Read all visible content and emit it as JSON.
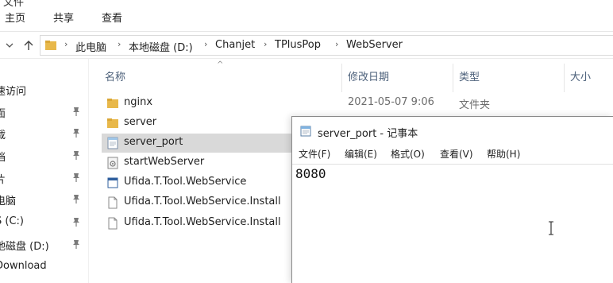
{
  "ribbon": {
    "tabs": [
      "主页",
      "共享",
      "查看"
    ],
    "top_cut_text": [
      "文件"
    ]
  },
  "address": {
    "crumbs": [
      "此电脑",
      "本地磁盘 (D:)",
      "Chanjet",
      "TPlusPop",
      "WebServer"
    ]
  },
  "navpane": {
    "items": [
      {
        "label": "速访问",
        "pinned": false
      },
      {
        "label": "面",
        "pinned": true
      },
      {
        "label": "载",
        "pinned": true
      },
      {
        "label": "档",
        "pinned": true
      },
      {
        "label": "片",
        "pinned": true
      },
      {
        "label": "电脑",
        "pinned": true
      },
      {
        "label": "S (C:)",
        "pinned": true
      },
      {
        "label": "地磁盘 (D:)",
        "pinned": true
      },
      {
        "label": "Download",
        "pinned": false
      }
    ]
  },
  "filelist": {
    "columns": [
      "名称",
      "修改日期",
      "类型",
      "大小"
    ],
    "rows": [
      {
        "name": "nginx",
        "icon": "folder-icon",
        "date": "2021-05-07 9:06",
        "type": "文件夹",
        "selected": false
      },
      {
        "name": "server",
        "icon": "folder-icon",
        "date": "",
        "type": "",
        "selected": false
      },
      {
        "name": "server_port",
        "icon": "text-file-icon",
        "date": "",
        "type": "",
        "selected": true
      },
      {
        "name": "startWebServer",
        "icon": "batch-file-icon",
        "date": "",
        "type": "",
        "selected": false
      },
      {
        "name": "Ufida.T.Tool.WebService",
        "icon": "app-file-icon",
        "date": "",
        "type": "",
        "selected": false
      },
      {
        "name": "Ufida.T.Tool.WebService.Install",
        "icon": "blank-file-icon",
        "date": "",
        "type": "",
        "selected": false
      },
      {
        "name": "Ufida.T.Tool.WebService.Install",
        "icon": "blank-file-icon",
        "date": "",
        "type": "",
        "selected": false
      }
    ]
  },
  "notepad": {
    "title": "server_port - 记事本",
    "menu": [
      "文件(F)",
      "编辑(E)",
      "格式(O)",
      "查看(V)",
      "帮助(H)"
    ],
    "content": "8080"
  },
  "colors": {
    "folder": "#e8b84a",
    "selection": "#d9d9d9",
    "header_text": "#4c607a"
  }
}
